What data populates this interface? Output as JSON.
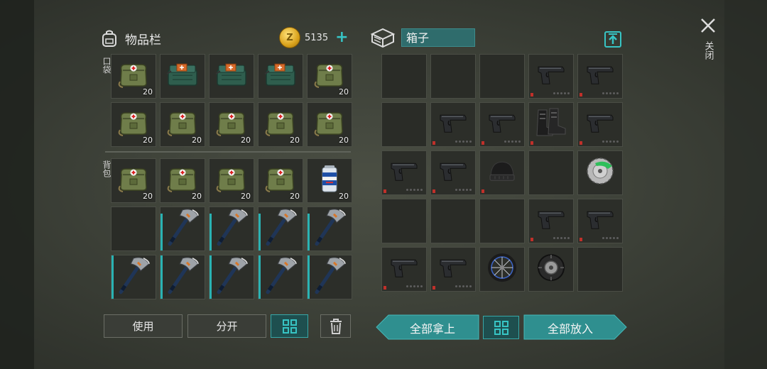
{
  "inventory": {
    "title": "物品栏",
    "coins": "5135",
    "coin_letter": "Z",
    "add_symbol": "+",
    "pocket_label": "口袋",
    "backpack_label": "背包"
  },
  "pocket_slots": [
    {
      "item": "medkit-bag-icon",
      "count": "20"
    },
    {
      "item": "first-aid-kit-icon",
      "count": ""
    },
    {
      "item": "first-aid-kit-icon",
      "count": ""
    },
    {
      "item": "first-aid-kit-icon",
      "count": ""
    },
    {
      "item": "medkit-bag-icon",
      "count": "20"
    },
    {
      "item": "medkit-bag-icon",
      "count": "20"
    },
    {
      "item": "medkit-bag-icon",
      "count": "20"
    },
    {
      "item": "medkit-bag-icon",
      "count": "20"
    },
    {
      "item": "medkit-bag-icon",
      "count": "20"
    },
    {
      "item": "medkit-bag-icon",
      "count": "20"
    }
  ],
  "backpack_slots": [
    {
      "item": "medkit-bag-icon",
      "count": "20"
    },
    {
      "item": "medkit-bag-icon",
      "count": "20"
    },
    {
      "item": "medkit-bag-icon",
      "count": "20"
    },
    {
      "item": "medkit-bag-icon",
      "count": "20"
    },
    {
      "item": "beer-can-icon",
      "count": "20"
    },
    {
      "item": "",
      "count": ""
    },
    {
      "item": "hatchet-icon",
      "count": "",
      "durability": 0.85
    },
    {
      "item": "hatchet-icon",
      "count": "",
      "durability": 0.85
    },
    {
      "item": "hatchet-icon",
      "count": "",
      "durability": 0.85
    },
    {
      "item": "hatchet-icon",
      "count": "",
      "durability": 0.85
    },
    {
      "item": "hatchet-icon",
      "count": "",
      "durability": 1.0
    },
    {
      "item": "hatchet-icon",
      "count": "",
      "durability": 1.0
    },
    {
      "item": "hatchet-icon",
      "count": "",
      "durability": 1.0
    },
    {
      "item": "hatchet-icon",
      "count": "",
      "durability": 1.0
    },
    {
      "item": "hatchet-icon",
      "count": "",
      "durability": 1.0
    }
  ],
  "box": {
    "title": "箱子"
  },
  "box_slots": [
    {
      "item": ""
    },
    {
      "item": ""
    },
    {
      "item": ""
    },
    {
      "item": "pistol-icon",
      "low": true
    },
    {
      "item": "pistol-icon",
      "low": true
    },
    {
      "item": ""
    },
    {
      "item": "pistol-icon",
      "low": true
    },
    {
      "item": "pistol-icon",
      "low": true
    },
    {
      "item": "boots-icon",
      "low": true
    },
    {
      "item": "pistol-icon",
      "low": true
    },
    {
      "item": "pistol-icon",
      "low": true
    },
    {
      "item": "pistol-icon",
      "low": true
    },
    {
      "item": "beanie-icon",
      "low": true
    },
    {
      "item": ""
    },
    {
      "item": "saw-blade-icon"
    },
    {
      "item": ""
    },
    {
      "item": ""
    },
    {
      "item": ""
    },
    {
      "item": "pistol-icon",
      "low": true
    },
    {
      "item": "pistol-icon",
      "low": true
    },
    {
      "item": "pistol-icon",
      "low": true
    },
    {
      "item": "pistol-icon",
      "low": true
    },
    {
      "item": "bike-wheel-icon"
    },
    {
      "item": "tire-icon"
    },
    {
      "item": ""
    }
  ],
  "buttons": {
    "use": "使用",
    "split": "分开",
    "take_all": "全部拿上",
    "put_all": "全部放入",
    "close": "关闭"
  },
  "colors": {
    "accent": "#2f8f8f",
    "highlight": "#37c4c4",
    "slot_bg": "#2c2e29",
    "low_durability": "#c0302a"
  }
}
